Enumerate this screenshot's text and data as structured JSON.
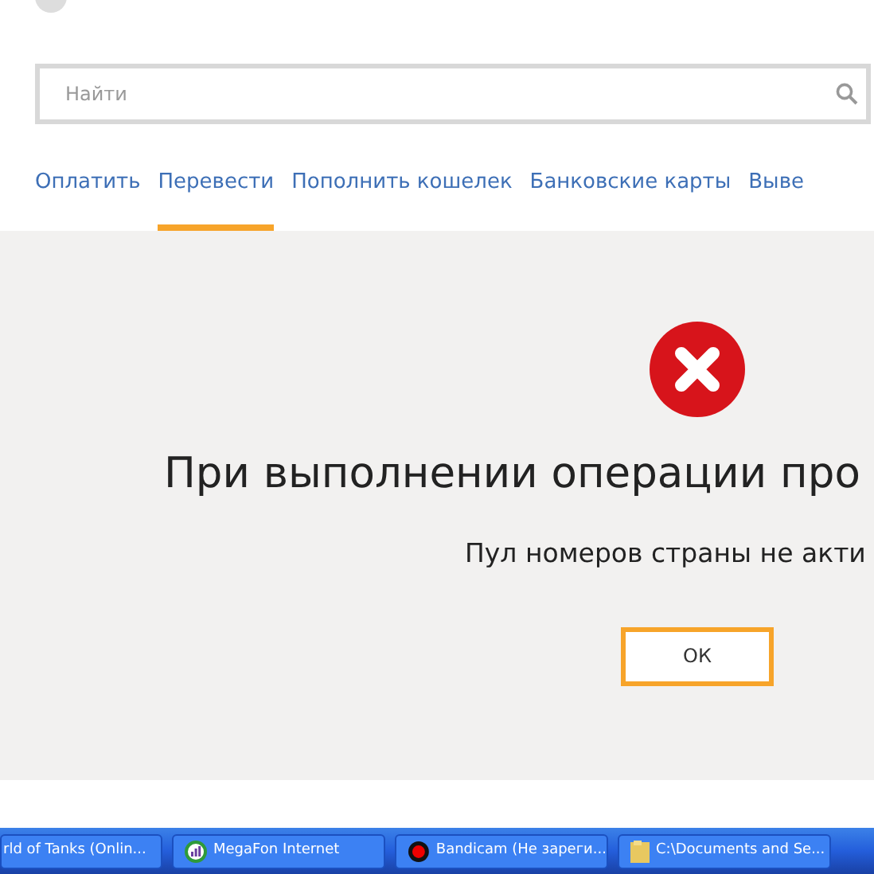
{
  "search": {
    "placeholder": "Найти"
  },
  "tabs": [
    {
      "label": "Оплатить",
      "selected": false
    },
    {
      "label": "Перевести",
      "selected": true
    },
    {
      "label": "Пополнить кошелек",
      "selected": false
    },
    {
      "label": "Банковские карты",
      "selected": false
    },
    {
      "label": "Выве",
      "selected": false
    }
  ],
  "error": {
    "title": "При выполнении операции про",
    "message": "Пул номеров страны не акти",
    "button": "ОК"
  },
  "taskbar": [
    {
      "label": "rld of Tanks (Onlin...",
      "kind": "none"
    },
    {
      "label": "MegaFon Internet",
      "kind": "megafon"
    },
    {
      "label": "Bandicam (Не зареги...",
      "kind": "record"
    },
    {
      "label": "C:\\Documents and Se...",
      "kind": "folder"
    }
  ]
}
